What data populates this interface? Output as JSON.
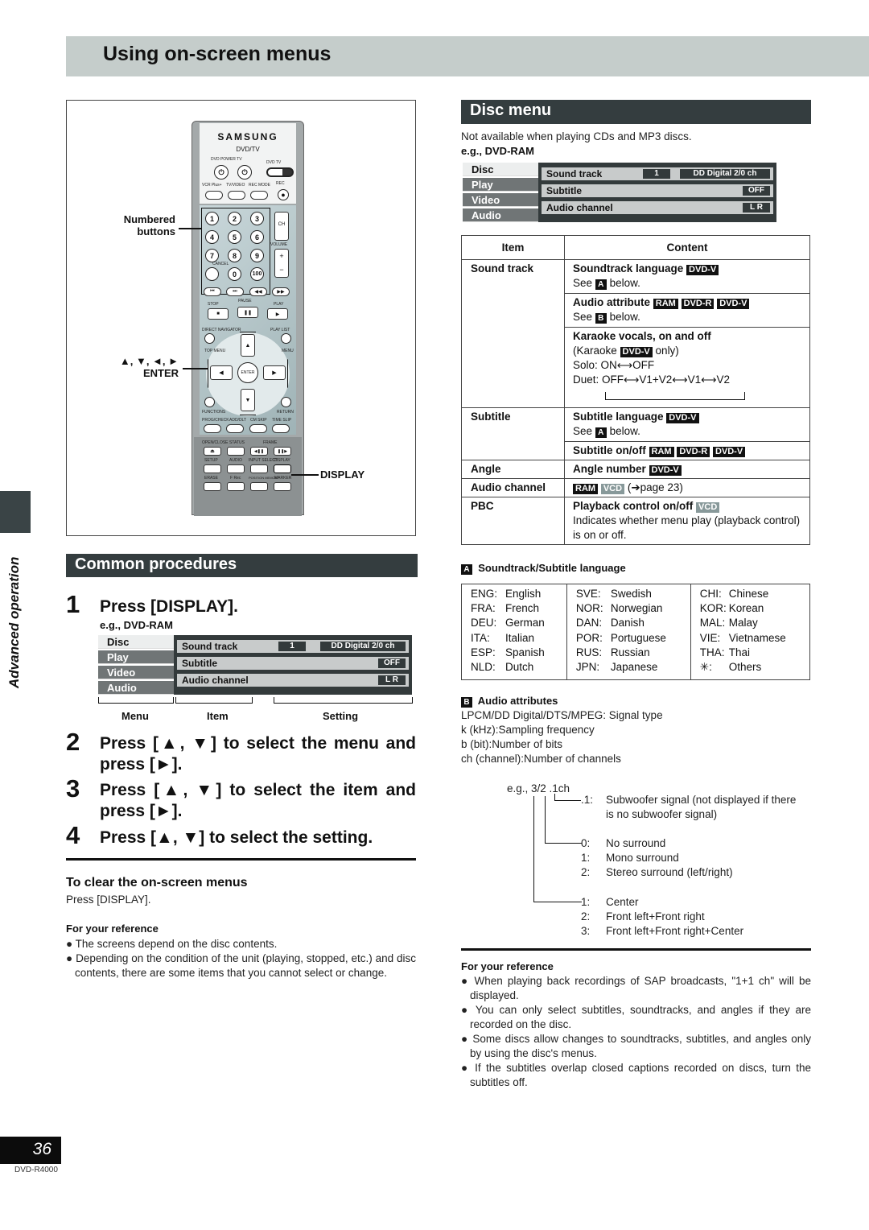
{
  "page_title": "Using on-screen menus",
  "side_label": "Advanced operation",
  "page_number": "36",
  "model": "DVD-R4000",
  "remote": {
    "brand": "SAMSUNG",
    "subtitle": "DVD/TV",
    "labels": {
      "power": "DVD POWER TV",
      "switch": "DVD TV",
      "vcr_plus": "VCR Plus+",
      "tv_video": "TV/VIDEO",
      "rec_mode": "REC MODE",
      "rec": "REC",
      "ch": "CH",
      "volume": "VOLUME",
      "cancel": "CANCEL",
      "stop": "STOP",
      "pause": "PAUSE",
      "play": "PLAY",
      "direct_navigator": "DIRECT NAVIGATOR",
      "play_list": "PLAY LIST",
      "top_menu": "TOP MENU",
      "menu": "MENU",
      "enter": "ENTER",
      "functions": "FUNCTIONS",
      "return": "RETURN",
      "prog_check": "PROG/CHECK",
      "add_dlt": "ADD/DLT",
      "cm_skip": "CM SKIP",
      "time_slip": "TIME SLIP",
      "open_close": "OPEN/CLOSE",
      "status": "STATUS",
      "frame": "FRAME",
      "setup": "SETUP",
      "audio": "AUDIO",
      "input_select": "INPUT SELECT",
      "display": "DISPLAY",
      "erase": "ERASE",
      "f_rec": "F Rec",
      "position_memory": "POSITION MEMORY",
      "marker": "MARKER"
    },
    "number_keys": [
      "1",
      "2",
      "3",
      "4",
      "5",
      "6",
      "7",
      "8",
      "9",
      "0",
      "100"
    ],
    "callouts": {
      "numbered_1": "Numbered",
      "numbered_2": "buttons",
      "arrows": "▲, ▼, ◄, ►",
      "enter": "ENTER",
      "display": "DISPLAY"
    }
  },
  "common": {
    "heading": "Common procedures",
    "steps": [
      {
        "num": "1",
        "text": "Press [DISPLAY]."
      },
      {
        "num": "2",
        "text": "Press [▲, ▼] to select the menu and press [►]."
      },
      {
        "num": "3",
        "text": "Press [▲, ▼] to select the item and press [►]."
      },
      {
        "num": "4",
        "text": "Press [▲, ▼] to select the setting."
      }
    ],
    "example_label": "e.g., DVD-RAM",
    "osd_captions": {
      "menu": "Menu",
      "item": "Item",
      "setting": "Setting"
    },
    "clear_heading": "To clear the on-screen menus",
    "clear_text": "Press [DISPLAY].",
    "ref_heading": "For your reference",
    "ref_bullets": [
      "The screens depend on the disc contents.",
      "Depending on the condition of the unit (playing, stopped, etc.) and disc contents, there are some items that you cannot select or change."
    ]
  },
  "osd": {
    "menus": [
      "Disc",
      "Play",
      "Video",
      "Audio"
    ],
    "rows": [
      {
        "label": "Sound track",
        "value1": "1",
        "value2": "DD Digital   2/0 ch"
      },
      {
        "label": "Subtitle",
        "value2": "OFF"
      },
      {
        "label": "Audio channel",
        "value2": "L R"
      }
    ]
  },
  "disc_menu": {
    "heading": "Disc menu",
    "note": "Not available when playing CDs and MP3 discs.",
    "example_label": "e.g., DVD-RAM",
    "table": {
      "headers": [
        "Item",
        "Content"
      ],
      "rows": {
        "sound_track": "Sound track",
        "st_lang": "Soundtrack language",
        "see_a": "See",
        "below": "below.",
        "audio_attr": "Audio attribute",
        "see_b": "See",
        "karaoke": "Karaoke vocals, on and off",
        "karaoke_note_pre": "(Karaoke",
        "karaoke_note_post": "only)",
        "solo": "Solo: ON⟷OFF",
        "duet": "Duet: OFF⟷V1+V2⟷V1⟷V2",
        "subtitle": "Subtitle",
        "sub_lang": "Subtitle language",
        "sub_onoff": "Subtitle on/off",
        "angle": "Angle",
        "angle_num": "Angle number",
        "audio_channel": "Audio channel",
        "page_ref": "(➔page 23)",
        "pbc": "PBC",
        "pbc_title": "Playback control on/off",
        "pbc_desc": "Indicates whether menu play (playback control) is on or off."
      },
      "tags": {
        "dvdv": "DVD-V",
        "ram": "RAM",
        "dvdr": "DVD-R",
        "vcd": "VCD",
        "a": "A",
        "b": "B"
      }
    },
    "lang_heading": "Soundtrack/Subtitle language",
    "languages": [
      [
        [
          "ENG:",
          "English"
        ],
        [
          "FRA:",
          "French"
        ],
        [
          "DEU:",
          "German"
        ],
        [
          "ITA:",
          "Italian"
        ],
        [
          "ESP:",
          "Spanish"
        ],
        [
          "NLD:",
          "Dutch"
        ]
      ],
      [
        [
          "SVE:",
          "Swedish"
        ],
        [
          "NOR:",
          "Norwegian"
        ],
        [
          "DAN:",
          "Danish"
        ],
        [
          "POR:",
          "Portuguese"
        ],
        [
          "RUS:",
          "Russian"
        ],
        [
          "JPN:",
          "Japanese"
        ]
      ],
      [
        [
          "CHI:",
          "Chinese"
        ],
        [
          "KOR:",
          "Korean"
        ],
        [
          "MAL:",
          "Malay"
        ],
        [
          "VIE:",
          "Vietnamese"
        ],
        [
          "THA:",
          "Thai"
        ],
        [
          "✳:",
          "Others"
        ]
      ]
    ],
    "attr_heading": "Audio attributes",
    "attr_lines": [
      "LPCM/DD Digital/DTS/MPEG: Signal type",
      "k (kHz):Sampling frequency",
      "b (bit):Number of bits",
      "ch (channel):Number of channels"
    ],
    "example_ch": "e.g., 3/2 .1ch",
    "ch_groups": [
      [
        [
          ".1:",
          "Subwoofer signal (not displayed if there"
        ],
        [
          "",
          "is no subwoofer signal)"
        ]
      ],
      [
        [
          "0:",
          "No surround"
        ],
        [
          "1:",
          "Mono surround"
        ],
        [
          "2:",
          "Stereo surround (left/right)"
        ]
      ],
      [
        [
          "1:",
          "Center"
        ],
        [
          "2:",
          "Front left+Front right"
        ],
        [
          "3:",
          "Front left+Front right+Center"
        ]
      ]
    ],
    "ref_heading": "For your reference",
    "ref_bullets": [
      "When playing back recordings of SAP broadcasts, \"1+1 ch\" will be displayed.",
      "You can only select subtitles, soundtracks, and angles if they are recorded on the disc.",
      "Some discs allow changes to soundtracks, subtitles, and angles only by using the disc's menus.",
      "If the subtitles overlap closed captions recorded on discs, turn the subtitles off."
    ]
  }
}
